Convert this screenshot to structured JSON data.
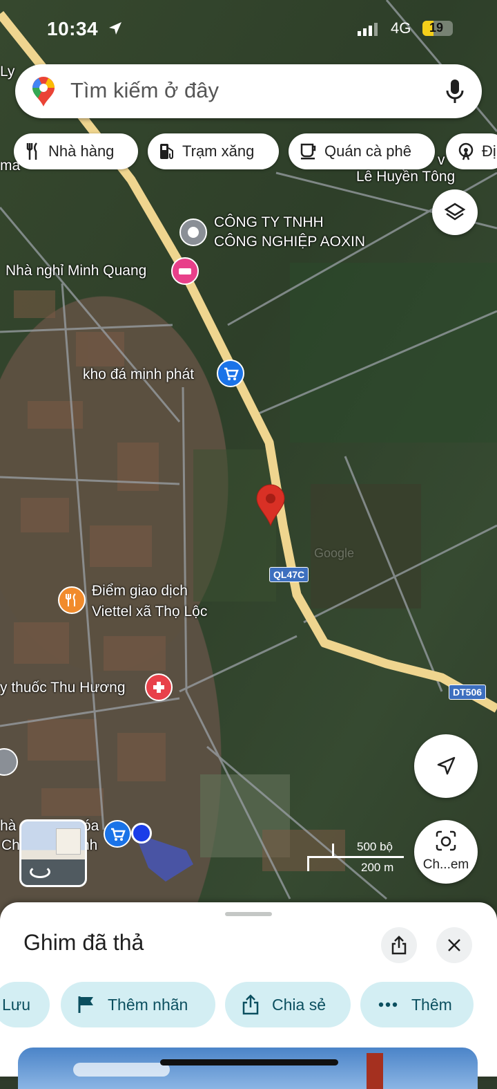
{
  "status_bar": {
    "time": "10:34",
    "network": "4G",
    "battery": "19"
  },
  "search": {
    "placeholder": "Tìm kiếm ở đây"
  },
  "chips": [
    {
      "label": "Nhà hàng",
      "icon": "fork-knife-icon"
    },
    {
      "label": "Trạm xăng",
      "icon": "gas-pump-icon"
    },
    {
      "label": "Quán cà phê",
      "icon": "coffee-cup-icon"
    },
    {
      "label": "Đị",
      "icon": "ferris-wheel-icon"
    }
  ],
  "map": {
    "labels": {
      "top_left": "Ly",
      "ma": "ma",
      "le_huyen_tong": "Lê Huyền Tông",
      "company_line1": "CÔNG TY TNHH",
      "company_line2": "CÔNG NGHIỆP AOXIN",
      "hotel": "Nhà nghỉ Minh Quang",
      "store": "kho đá minh phát",
      "viettel_line1": "Điểm giao dịch",
      "viettel_line2": "Viettel xã Thọ Lộc",
      "pharmacy": "y thuốc Thu Hương",
      "bottom_left1": "hà",
      "bottom_left2": "óa",
      "bottom_left3": "Ch",
      "bottom_left4": "nh",
      "v_mark": "v",
      "watermark": "Google"
    },
    "road_tags": [
      "QL47C",
      "DT506"
    ],
    "scale": {
      "top": "500 bộ",
      "bottom": "200 m"
    },
    "camera_button_label": "Ch...em"
  },
  "sheet": {
    "title": "Ghim đã thả",
    "actions": [
      {
        "label": "Lưu",
        "icon": "bookmark-icon"
      },
      {
        "label": "Thêm nhãn",
        "icon": "flag-icon"
      },
      {
        "label": "Chia sẻ",
        "icon": "share-icon"
      },
      {
        "label": "Thêm",
        "icon": "more-dots-icon"
      }
    ]
  },
  "colors": {
    "pin_red": "#d93025",
    "road_yellow": "#efd58f",
    "action_bg": "#d3eef3",
    "action_text": "#0b4f5f",
    "poi_blue": "#1a73e8",
    "poi_orange": "#f18b2c",
    "poi_pink": "#e8408a",
    "poi_gray": "#8a8f96"
  }
}
